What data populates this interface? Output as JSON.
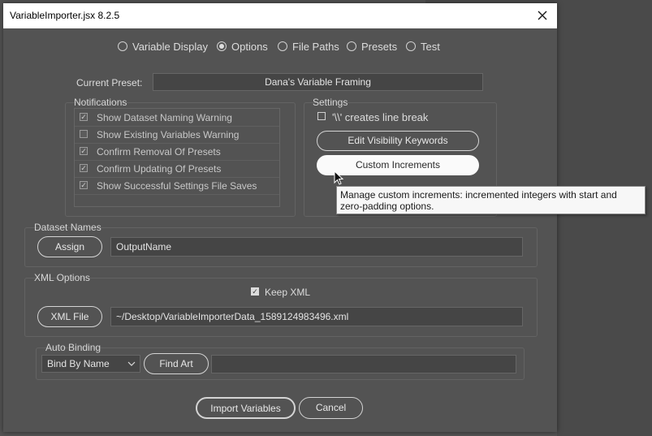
{
  "window": {
    "title": "VariableImporter.jsx 8.2.5"
  },
  "tabs": [
    {
      "label": "Variable Display",
      "selected": false
    },
    {
      "label": "Options",
      "selected": true
    },
    {
      "label": "File Paths",
      "selected": false
    },
    {
      "label": "Presets",
      "selected": false
    },
    {
      "label": "Test",
      "selected": false
    }
  ],
  "preset": {
    "label": "Current Preset:",
    "value": "Dana's Variable Framing"
  },
  "notifications": {
    "title": "Notifications",
    "items": [
      {
        "label": "Show Dataset Naming Warning",
        "checked": true
      },
      {
        "label": "Show Existing Variables Warning",
        "checked": false
      },
      {
        "label": "Confirm Removal Of Presets",
        "checked": true
      },
      {
        "label": "Confirm Updating Of Presets",
        "checked": true
      },
      {
        "label": "Show Successful Settings File Saves",
        "checked": true
      }
    ]
  },
  "settings": {
    "title": "Settings",
    "line_break_label": "'\\\\' creates line break",
    "line_break_checked": false,
    "edit_visibility_label": "Edit Visibility Keywords",
    "custom_increments_label": "Custom Increments"
  },
  "tooltip": {
    "text": "Manage custom increments: incremented integers with start and zero-padding options."
  },
  "dataset_names": {
    "title": "Dataset Names",
    "assign_label": "Assign",
    "value": "OutputName"
  },
  "xml_options": {
    "title": "XML Options",
    "keep_xml_label": "Keep XML",
    "keep_xml_checked": true,
    "xml_file_label": "XML File",
    "path": "~/Desktop/VariableImporterData_1589124983496.xml"
  },
  "auto_binding": {
    "title": "Auto Binding",
    "mode": "Bind By Name",
    "find_art_label": "Find Art",
    "value": ""
  },
  "footer": {
    "import_label": "Import Variables",
    "cancel_label": "Cancel"
  }
}
